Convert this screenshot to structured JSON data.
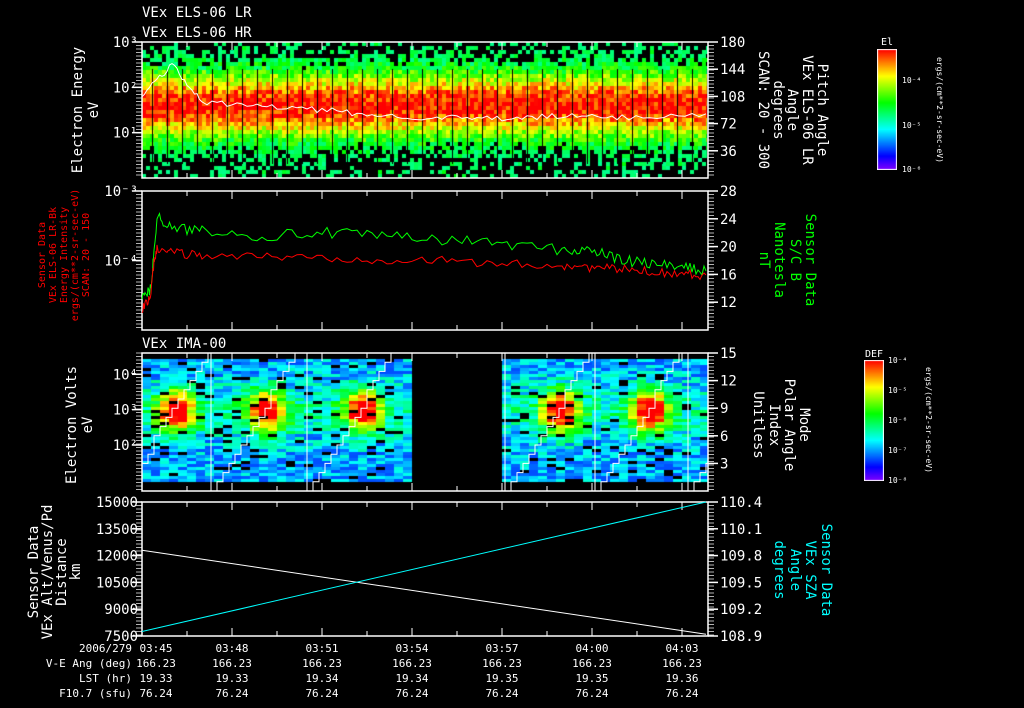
{
  "titles": {
    "panel1_a": "VEx ELS-06 LR",
    "panel1_b": "VEx ELS-06 HR",
    "panel3": "VEx IMA-00"
  },
  "labels": {
    "p1_left": [
      "Electron Energy",
      "eV"
    ],
    "p1_right": [
      "Pitch Angle",
      "VEx ELS-06 LR",
      "Angle",
      "degrees",
      "SCAN: 20 - 300"
    ],
    "p2_left": [
      "Sensor Data",
      "VEx ELS-06 LR-Bk",
      "Energy Intensity",
      "ergs/(cm**2-sr-sec-eV)",
      "SCAN: 20 - 150"
    ],
    "p2_right": [
      "Sensor Data",
      "S/C B",
      "Nanotesla",
      "nT"
    ],
    "p3_left": [
      "Electron Volts",
      "eV"
    ],
    "p3_right": [
      "Mode",
      "Polar Angle",
      "Index",
      "Unitless"
    ],
    "p4_left": [
      "Sensor Data",
      "VEx Alt/Venus/Pd",
      "Distance",
      "km"
    ],
    "p4_right": [
      "Sensor Data",
      "VEx SZA",
      "Angle",
      "degrees"
    ]
  },
  "colorbars": [
    {
      "title": "El",
      "ticks": [
        "10⁻⁴",
        "10⁻⁵",
        "10⁻⁶"
      ],
      "units": "ergs/(cm**2-sr-sec-eV)"
    },
    {
      "title": "DEF",
      "ticks": [
        "10⁻⁴",
        "10⁻⁵",
        "10⁻⁶",
        "10⁻⁷",
        "10⁻⁸"
      ],
      "units": "ergs/(cm**2-sr-sec-eV)"
    }
  ],
  "colors": {
    "white": "#ffffff",
    "green": "#00ff00",
    "red": "#ff0000",
    "cyan": "#00ffff"
  },
  "footer": {
    "row_labels": [
      "2006/279",
      "V-E Ang (deg)",
      "LST (hr)",
      "F10.7 (sfu)"
    ],
    "times": [
      "03:45",
      "03:48",
      "03:51",
      "03:54",
      "03:57",
      "04:00",
      "04:03"
    ],
    "ve_ang": [
      "166.23",
      "166.23",
      "166.23",
      "166.23",
      "166.23",
      "166.23",
      "166.23"
    ],
    "lst": [
      "19.33",
      "19.33",
      "19.34",
      "19.34",
      "19.35",
      "19.35",
      "19.36"
    ],
    "f107": [
      "76.24",
      "76.24",
      "76.24",
      "76.24",
      "76.24",
      "76.24",
      "76.24"
    ]
  },
  "chart_data": [
    {
      "type": "heatmap",
      "title": "VEx ELS-06 LR / VEx ELS-06 HR",
      "ylabel": "Electron Energy (eV)",
      "yscale": "log",
      "ylim": [
        1,
        1000
      ],
      "yticks": [
        "10¹",
        "10²",
        "10³"
      ],
      "y2label": "Pitch Angle (degrees)",
      "y2lim": [
        0,
        180
      ],
      "y2ticks": [
        "36",
        "72",
        "108",
        "144",
        "180"
      ],
      "xlim_minutes": [
        0,
        18.9
      ],
      "peak_energy_ev": 40,
      "overlay_line": {
        "name": "pitch angle",
        "color": "#ffffff",
        "x_min": [
          0,
          1,
          2,
          4,
          6,
          8,
          10,
          12,
          14,
          16,
          18.8
        ],
        "y": [
          110,
          150,
          100,
          95,
          90,
          82,
          80,
          78,
          82,
          80,
          85
        ]
      }
    },
    {
      "type": "line",
      "ylabel": "Energy Intensity",
      "yscale": "log",
      "ylim": [
        1e-05,
        0.001
      ],
      "yticks": [
        "10⁻⁴",
        "10⁻³"
      ],
      "y2label": "S/C B (nT)",
      "y2lim": [
        8,
        28
      ],
      "y2ticks": [
        "12",
        "16",
        "20",
        "24",
        "28"
      ],
      "series": [
        {
          "name": "ELS energy intensity",
          "color": "#ff0000",
          "axis": "left",
          "x_min": [
            0,
            0.3,
            0.5,
            1,
            2,
            4,
            6,
            8,
            10,
            12,
            14,
            15,
            16,
            17,
            18,
            18.8
          ],
          "y": [
            2e-05,
            3e-05,
            0.00015,
            0.00013,
            0.00012,
            0.000115,
            0.00011,
            0.000105,
            0.0001,
            9e-05,
            8.5e-05,
            8e-05,
            7.5e-05,
            7e-05,
            6.5e-05,
            6.2e-05
          ]
        },
        {
          "name": "S/C B",
          "color": "#00ff00",
          "axis": "right",
          "x_min": [
            0,
            0.3,
            0.5,
            1,
            2,
            4,
            6,
            8,
            10,
            12,
            14,
            15,
            16,
            17,
            18,
            18.8
          ],
          "y": [
            12.5,
            14,
            24.5,
            22.5,
            22.5,
            21.5,
            22,
            21.5,
            21,
            20.5,
            19.5,
            19.5,
            18,
            17.5,
            17,
            16.5
          ]
        }
      ]
    },
    {
      "type": "heatmap",
      "title": "VEx IMA-00",
      "ylabel": "Electron Volts (eV)",
      "yscale": "log",
      "ylim": [
        5,
        40000
      ],
      "yticks": [
        "10²",
        "10³",
        "10⁴"
      ],
      "y2label": "Polar Angle Index",
      "y2lim": [
        0,
        15
      ],
      "y2ticks": [
        "3",
        "6",
        "9",
        "12",
        "15"
      ],
      "peak_energy_ev": 1000,
      "data_gap_minutes": [
        8.8,
        11.8
      ],
      "overlay_line": {
        "name": "polar angle index",
        "color": "#ffffff",
        "sweep_start_minutes": [
          -0.7,
          2.3,
          5.5,
          12.1,
          15.1,
          18.2
        ]
      }
    },
    {
      "type": "line",
      "ylabel": "Distance (km)",
      "ylim": [
        7500,
        15000
      ],
      "yticks": [
        "7500",
        "9000",
        "10500",
        "12000",
        "13500",
        "15000"
      ],
      "y2label": "VEx SZA Angle (degrees)",
      "y2lim": [
        108.9,
        110.4
      ],
      "y2ticks": [
        "108.9",
        "109.2",
        "109.5",
        "109.8",
        "110.1",
        "110.4"
      ],
      "series": [
        {
          "name": "VEx Alt",
          "color": "#ffffff",
          "axis": "left",
          "x_min": [
            0,
            18.8
          ],
          "y": [
            12300,
            7600
          ]
        },
        {
          "name": "VEx SZA",
          "color": "#00ffff",
          "axis": "right",
          "x_min": [
            0,
            18.8
          ],
          "y": [
            108.95,
            110.4
          ]
        }
      ]
    }
  ]
}
